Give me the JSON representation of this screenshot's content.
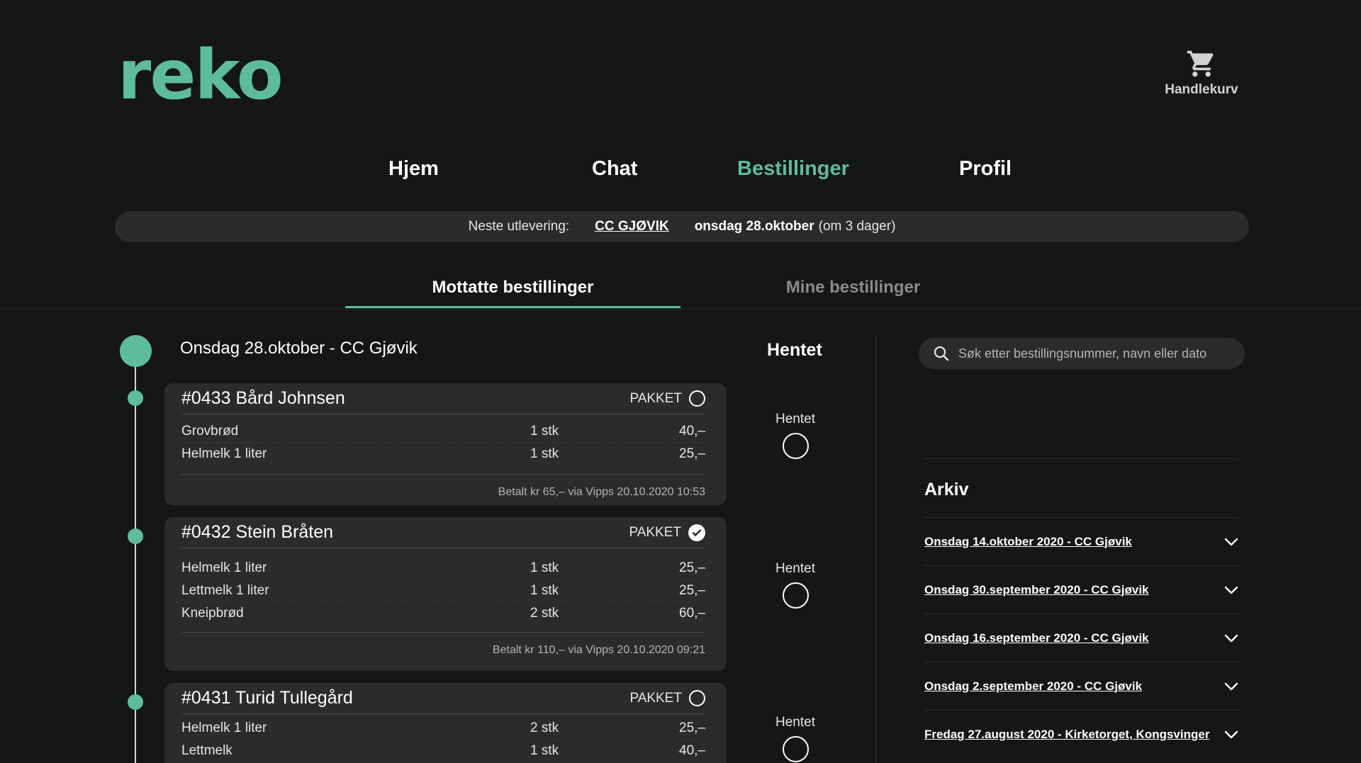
{
  "header": {
    "logo": "reko",
    "cart_label": "Handlekurv"
  },
  "nav": {
    "items": [
      {
        "label": "Hjem"
      },
      {
        "label": "Chat"
      },
      {
        "label": "Bestillinger"
      },
      {
        "label": "Profil"
      }
    ],
    "active": "Bestillinger"
  },
  "delivery": {
    "label": "Neste utlevering:",
    "place": "CC GJØVIK",
    "date": "onsdag 28.oktober",
    "relative": "(om 3 dager)"
  },
  "subtabs": {
    "received": "Mottatte bestillinger",
    "mine": "Mine bestillinger"
  },
  "group": {
    "title": "Onsdag 28.oktober - CC Gjøvik",
    "hentet_heading": "Hentet"
  },
  "orders": [
    {
      "title": "#0433 Bård Johnsen",
      "status": "PAKKET",
      "packed": false,
      "items": [
        {
          "name": "Grovbrød",
          "qty": "1 stk",
          "price": "40,–"
        },
        {
          "name": "Helmelk 1 liter",
          "qty": "1 stk",
          "price": "25,–"
        }
      ],
      "payment": "Betalt kr 65,– via Vipps  20.10.2020 10:53",
      "hentet_label": "Hentet"
    },
    {
      "title": "#0432 Stein Bråten",
      "status": "PAKKET",
      "packed": true,
      "items": [
        {
          "name": "Helmelk 1 liter",
          "qty": "1 stk",
          "price": "25,–"
        },
        {
          "name": "Lettmelk 1 liter",
          "qty": "1 stk",
          "price": "25,–"
        },
        {
          "name": "Kneipbrød",
          "qty": "2 stk",
          "price": "60,–"
        }
      ],
      "payment": "Betalt kr 110,– via Vipps  20.10.2020 09:21",
      "hentet_label": "Hentet"
    },
    {
      "title": "#0431 Turid Tullegård",
      "status": "PAKKET",
      "packed": false,
      "items": [
        {
          "name": "Helmelk 1 liter",
          "qty": "2 stk",
          "price": "25,–"
        },
        {
          "name": "Lettmelk",
          "qty": "1 stk",
          "price": "40,–"
        }
      ],
      "payment": "",
      "hentet_label": "Hentet"
    }
  ],
  "search": {
    "placeholder": "Søk etter bestillingsnummer, navn eller dato"
  },
  "archive": {
    "title": "Arkiv",
    "items": [
      {
        "label": "Onsdag 14.oktober 2020 - CC Gjøvik"
      },
      {
        "label": "Onsdag 30.september 2020 - CC Gjøvik"
      },
      {
        "label": "Onsdag 16.september 2020 - CC Gjøvik"
      },
      {
        "label": "Onsdag 2.september 2020 - CC Gjøvik"
      },
      {
        "label": "Fredag 27.august 2020 - Kirketorget, Kongsvinger"
      }
    ]
  },
  "colors": {
    "accent": "#5fbc9a",
    "background": "#151616",
    "card": "#2a2c2c"
  },
  "icons": {
    "cart": "cart-icon",
    "search": "search-icon",
    "chevron": "chevron-down-icon",
    "check": "check-circle-icon"
  }
}
